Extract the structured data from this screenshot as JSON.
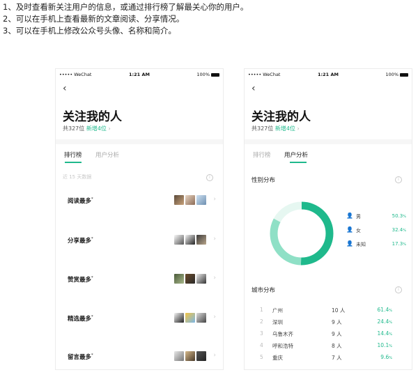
{
  "intro": [
    "1、及时查看新关注用户的信息，或通过排行榜了解最关心你的用户。",
    "2、可以在手机上查看最新的文章阅读、分享情况。",
    "3、可以在手机上修改公众号头像、名称和简介。"
  ],
  "status": {
    "carrier": "••••• WeChat",
    "time": "1:21 AM",
    "battery": "100%"
  },
  "header": {
    "back": "‹",
    "title": "关注我的人",
    "total": "共327位",
    "new": "新增4位",
    "arrow": "›"
  },
  "tabs": {
    "ranking": "排行榜",
    "analysis": "用户分析"
  },
  "ranking": {
    "hint": "近 15 天数据",
    "rows": [
      {
        "label": "阅读最多",
        "sup": "*"
      },
      {
        "label": "分享最多",
        "sup": "*"
      },
      {
        "label": "赞赏最多",
        "sup": "*"
      },
      {
        "label": "精选最多",
        "sup": "*"
      },
      {
        "label": "留言最多",
        "sup": "*"
      }
    ]
  },
  "gender": {
    "title": "性别分布",
    "items": [
      {
        "label": "男",
        "pct": "50.3",
        "unit": "%"
      },
      {
        "label": "女",
        "pct": "32.4",
        "unit": "%"
      },
      {
        "label": "未知",
        "pct": "17.3",
        "unit": "%"
      }
    ]
  },
  "city": {
    "title": "城市分布",
    "rows": [
      {
        "n": "1",
        "name": "广州",
        "count": "10 人",
        "pct": "61.4",
        "unit": "%"
      },
      {
        "n": "2",
        "name": "深圳",
        "count": "9 人",
        "pct": "24.4",
        "unit": "%"
      },
      {
        "n": "3",
        "name": "乌鲁木齐",
        "count": "9 人",
        "pct": "14.4",
        "unit": "%"
      },
      {
        "n": "4",
        "name": "呼和浩特",
        "count": "8 人",
        "pct": "10.1",
        "unit": "%"
      },
      {
        "n": "5",
        "name": "重庆",
        "count": "7 人",
        "pct": "9.6",
        "unit": "%"
      }
    ]
  },
  "chart_data": {
    "type": "pie",
    "categories": [
      "男",
      "女",
      "未知"
    ],
    "values": [
      50.3,
      32.4,
      17.3
    ],
    "title": "性别分布"
  },
  "colors": {
    "accent": "#1fb98c",
    "accent_mid": "#8fe0c6",
    "accent_light": "#e6f7f1"
  }
}
